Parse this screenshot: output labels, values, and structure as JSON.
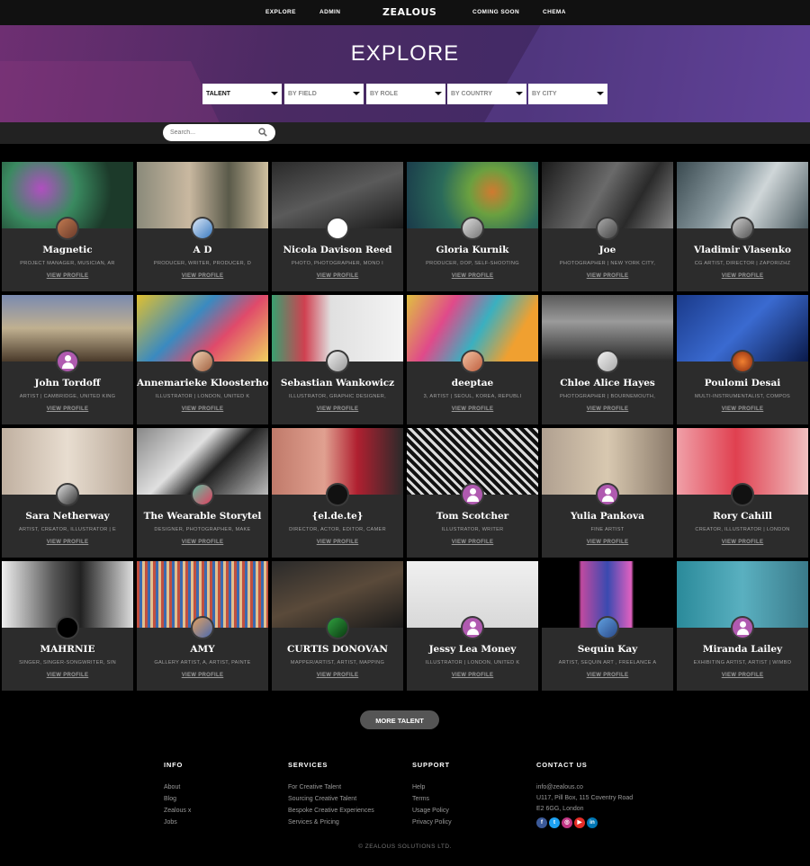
{
  "nav": {
    "links": [
      "EXPLORE",
      "ADMIN",
      "COMING SOON",
      "CHEMA"
    ],
    "logo": "ZEALOUS"
  },
  "hero": {
    "title": "EXPLORE",
    "filters": [
      "TALENT",
      "BY FIELD",
      "BY ROLE",
      "BY COUNTRY",
      "BY CITY"
    ]
  },
  "search": {
    "placeholder": "Search..."
  },
  "profile_link": "VIEW PROFILE",
  "cards": [
    {
      "name": "Magnetic",
      "roles": "PROJECT MANAGER, MUSICIAN, AR",
      "view": "VIEW PROFILE"
    },
    {
      "name": "A D",
      "roles": "PRODUCER, WRITER, PRODUCER, D",
      "view": "VIEW PROFILE"
    },
    {
      "name": "Nicola Davison Reed",
      "roles": "PHOTO, PHOTOGRAPHER, MONO I",
      "view": "VIEW PROFILE"
    },
    {
      "name": "Gloria Kurnik",
      "roles": "PRODUCER, DOP, SELF-SHOOTING",
      "view": "VIEW PROFILE"
    },
    {
      "name": "Joe",
      "roles": "PHOTOGRAPHER | NEW YORK CITY,",
      "view": "VIEW PROFILE"
    },
    {
      "name": "Vladimir Vlasenko",
      "roles": "CG ARTIST, DIRECTOR | ZAPORIZHZ",
      "view": "VIEW PROFILE"
    },
    {
      "name": "John Tordoff",
      "roles": "ARTIST | CAMBRIDGE, UNITED KING",
      "view": "VIEW PROFILE"
    },
    {
      "name": "Annemarieke Kloosterhof",
      "roles": "ILLUSTRATOR | LONDON, UNITED K",
      "view": "VIEW PROFILE"
    },
    {
      "name": "Sebastian Wankowicz",
      "roles": "ILLUSTRATOR, GRAPHIC DESIGNER,",
      "view": "VIEW PROFILE"
    },
    {
      "name": "deeptae",
      "roles": "3, ARTIST | SEOUL, KOREA, REPUBLI",
      "view": "VIEW PROFILE"
    },
    {
      "name": "Chloe Alice Hayes",
      "roles": "PHOTOGRAPHER | BOURNEMOUTH,",
      "view": "VIEW PROFILE"
    },
    {
      "name": "Poulomi Desai",
      "roles": "MULTI-INSTRUMENTALIST, COMPOS",
      "view": "VIEW PROFILE"
    },
    {
      "name": "Sara Netherway",
      "roles": "ARTIST, CREATOR, ILLUSTRATOR | E",
      "view": "VIEW PROFILE"
    },
    {
      "name": "The Wearable Storytel",
      "roles": "DESIGNER, PHOTOGRAPHER, MAKE",
      "view": "VIEW PROFILE"
    },
    {
      "name": "{el.de.te}",
      "roles": "DIRECTOR, ACTOR, EDITOR, CAMER",
      "view": "VIEW PROFILE"
    },
    {
      "name": "Tom Scotcher",
      "roles": "ILLUSTRATOR, WRITER",
      "view": "VIEW PROFILE"
    },
    {
      "name": "Yulia Pankova",
      "roles": "FINE ARTIST",
      "view": "VIEW PROFILE"
    },
    {
      "name": "Rory Cahill",
      "roles": "CREATOR, ILLUSTRATOR | LONDON",
      "view": "VIEW PROFILE"
    },
    {
      "name": "MAHRNIE",
      "roles": "SINGER, SINGER-SONGWRITER, SIN",
      "view": "VIEW PROFILE"
    },
    {
      "name": "AMY",
      "roles": "GALLERY ARTIST, A, ARTIST, PAINTE",
      "view": "VIEW PROFILE"
    },
    {
      "name": "CURTIS DONOVAN",
      "roles": "MAPPER/ARTIST, ARTIST, MAPPING",
      "view": "VIEW PROFILE"
    },
    {
      "name": "Jessy Lea Money",
      "roles": "ILLUSTRATOR | LONDON, UNITED K",
      "view": "VIEW PROFILE"
    },
    {
      "name": "Sequin Kay",
      "roles": "ARTIST, SEQUIN ART , FREELANCE A",
      "view": "VIEW PROFILE"
    },
    {
      "name": "Miranda Lailey",
      "roles": "EXHIBITING ARTIST, ARTIST | WIMBO",
      "view": "VIEW PROFILE"
    }
  ],
  "more_button": "MORE TALENT",
  "footer": {
    "info": {
      "heading": "INFO",
      "links": [
        "About",
        "Blog",
        "Zealous x",
        "Jobs"
      ]
    },
    "services": {
      "heading": "SERVICES",
      "links": [
        "For Creative Talent",
        "Sourcing Creative Talent",
        "Bespoke Creative Experiences",
        "Services & Pricing"
      ]
    },
    "support": {
      "heading": "SUPPORT",
      "links": [
        "Help",
        "Terms",
        "Usage Policy",
        "Privacy Policy"
      ]
    },
    "contact": {
      "heading": "CONTACT US",
      "email": "info@zealous.co",
      "address1": "U117, Pill Box, 115 Coventry Road",
      "address2": "E2 6GG, London"
    },
    "socials": [
      {
        "icon": "facebook-icon",
        "glyph": "f",
        "color": "#3b5998"
      },
      {
        "icon": "twitter-icon",
        "glyph": "t",
        "color": "#1da1f2"
      },
      {
        "icon": "instagram-icon",
        "glyph": "◎",
        "color": "#c13584"
      },
      {
        "icon": "youtube-icon",
        "glyph": "▶",
        "color": "#e52d27"
      },
      {
        "icon": "linkedin-icon",
        "glyph": "in",
        "color": "#0077b5"
      }
    ],
    "copyright": "© ZEALOUS SOLUTIONS LTD."
  },
  "colors": {
    "accent_purple": "#b05ab0",
    "card_bg": "#2c2c2c",
    "hero_purple": "#4b2a63"
  }
}
